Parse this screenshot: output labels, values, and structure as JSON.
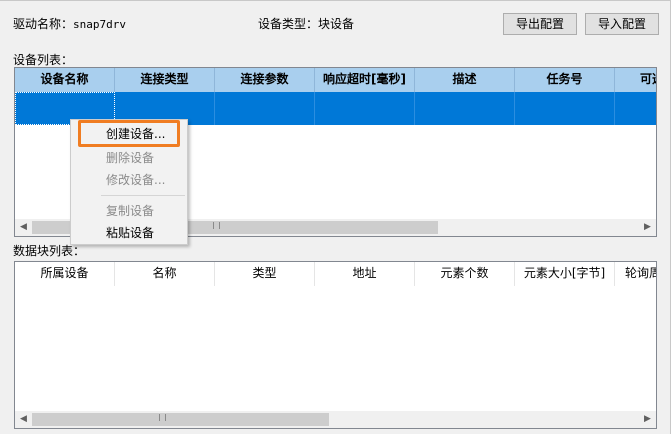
{
  "header": {
    "driver_label": "驱动名称：",
    "driver_name": "snap7drv",
    "device_type_label": "设备类型：",
    "device_type_value": "块设备",
    "export_button": "导出配置",
    "import_button": "导入配置"
  },
  "device_list": {
    "label": "设备列表：",
    "columns": [
      "设备名称",
      "连接类型",
      "连接参数",
      "响应超时[毫秒]",
      "描述",
      "任务号",
      "可选"
    ],
    "selected_row_index": 0,
    "header_color": "#a9cfee",
    "selection_color": "#0078d7"
  },
  "context_menu": {
    "items": [
      {
        "label": "创建设备...",
        "enabled": true,
        "highlighted": true
      },
      {
        "label": "删除设备",
        "enabled": false
      },
      {
        "label": "修改设备...",
        "enabled": false
      },
      {
        "label": "复制设备",
        "enabled": false
      },
      {
        "label": "粘贴设备",
        "enabled": true
      }
    ],
    "highlight_color": "#f07d22"
  },
  "block_list": {
    "label": "数据块列表：",
    "columns": [
      "所属设备",
      "名称",
      "类型",
      "地址",
      "元素个数",
      "元素大小[字节]",
      "轮询周"
    ]
  }
}
